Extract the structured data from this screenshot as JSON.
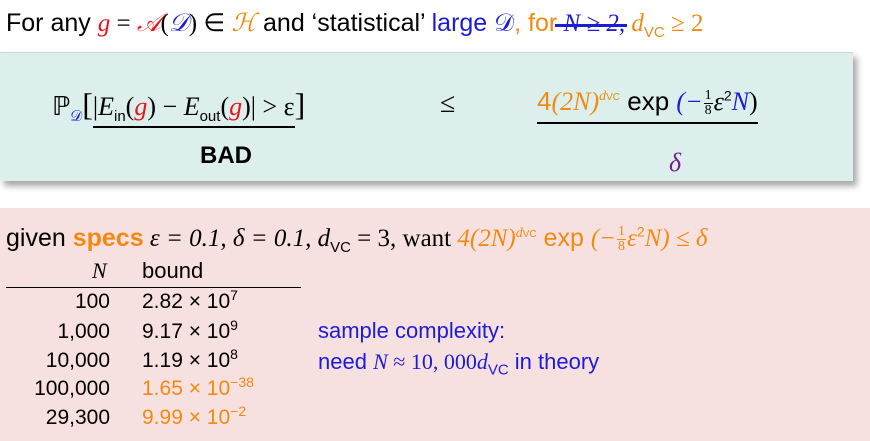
{
  "header": {
    "prefix": "For any ",
    "g": "g",
    "eq": " = ",
    "A": "𝒜",
    "open": "(",
    "D": "𝒟",
    "close": ")",
    "in": " ∈ ",
    "H": "ℋ",
    "and_text": " and ‘statistical’ ",
    "large_D": "large 𝒟",
    "comma": ", ",
    "for_text": "for",
    "struck": " N ≥ 2,",
    "dvc_cond": " d",
    "vc": "VC",
    "geq2": " ≥ 2"
  },
  "inequality": {
    "P": "ℙ",
    "Psub": "𝒟",
    "lbr": "[",
    "abs_open": "|",
    "Ein": "E",
    "in_sub": "in",
    "g1": "g",
    "minus": " − ",
    "Eout": "E",
    "out_sub": "out",
    "g2": "g",
    "abs_close": "|",
    "gt": " > ε",
    "rbr": "]",
    "bad_label": "BAD",
    "leq": "≤",
    "four": "4",
    "twoN": "(2N)",
    "dvc_exp": "d",
    "vc_exp": "VC",
    "exp": " exp ",
    "minus_frac_pre": "(−",
    "frac_num": "1",
    "frac_den": "8",
    "eps2": "ε",
    "two": "2",
    "N": "N",
    "rparen": ")",
    "delta_label": "δ"
  },
  "given": {
    "given_text": "given ",
    "specs": "specs",
    "eps": " ε = 0.1, δ = 0.1, ",
    "dvc": "d",
    "vc": "VC",
    "eq3": " = 3, want ",
    "want_expr": "4(2N)",
    "want_dvc": "d",
    "want_vc": "VC",
    "want_exp": " exp ",
    "want_paren": "(−",
    "want_num": "1",
    "want_den": "8",
    "want_eps": "ε",
    "want_sq": "2",
    "want_N": "N)",
    "want_leq": " ≤ δ"
  },
  "table": {
    "col_N": "N",
    "col_bound": "bound",
    "rows": [
      {
        "N": "100",
        "mant": "2.82 × 10",
        "exp": "7",
        "color": "#000000"
      },
      {
        "N": "1,000",
        "mant": "9.17 × 10",
        "exp": "9",
        "color": "#000000"
      },
      {
        "N": "10,000",
        "mant": "1.19 × 10",
        "exp": "8",
        "color": "#000000"
      },
      {
        "N": "100,000",
        "mant": "1.65 × 10",
        "exp": "−38",
        "color": "#f28a12"
      },
      {
        "N": "29,300",
        "mant": "9.99 × 10",
        "exp": "−2",
        "color": "#f28a12"
      }
    ]
  },
  "sample_complexity": {
    "line1": "sample complexity:",
    "line2_pre": "need ",
    "line2_N": "N",
    "line2_mid": " ≈ 10, 000",
    "line2_d": "d",
    "line2_vc": "VC",
    "line2_post": " in theory"
  },
  "colors": {
    "green_box": "#dcefec",
    "pink_box": "#f7e0e0",
    "red": "#e8141e",
    "blue": "#1c1cd6",
    "orange": "#f28a12",
    "purple": "#7a1a8c"
  }
}
